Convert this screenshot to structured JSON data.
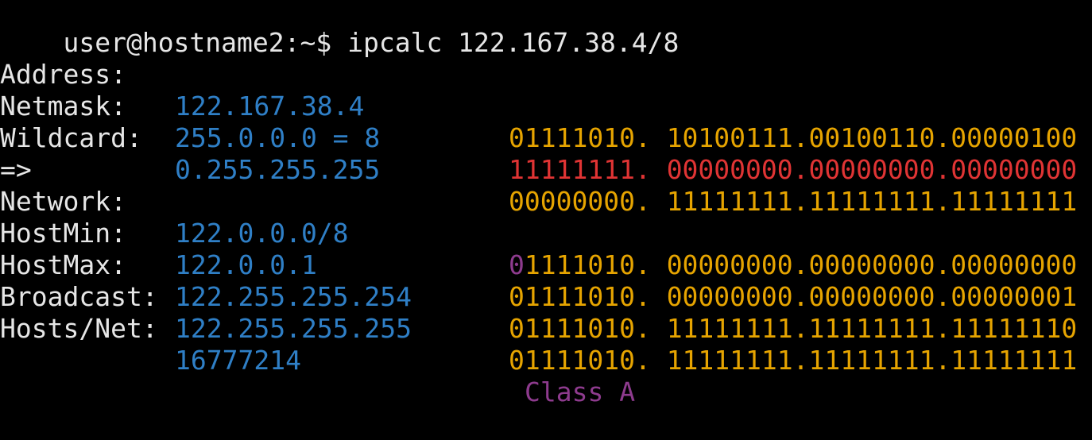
{
  "prompt": "user@hostname2:~$ ipcalc 122.167.38.4/8",
  "rows": [
    {
      "label": "Address:",
      "value": "122.167.38.4",
      "bin_first": "01111010",
      "bin_rest": ". 10100111.00100110.00000100"
    },
    {
      "label": "Netmask:",
      "value": "255.0.0.0 = 8",
      "bin_first": "11111111",
      "bin_rest": ". 00000000.00000000.00000000"
    },
    {
      "label": "Wildcard:",
      "value": "0.255.255.255",
      "bin_first": "00000000",
      "bin_rest": ". 11111111.11111111.11111111"
    },
    {
      "label": "=>"
    },
    {
      "label": "Network:",
      "value": "122.0.0.0/8",
      "bin_classbit": "0",
      "bin_first": "1111010",
      "bin_rest": ". 00000000.00000000.00000000"
    },
    {
      "label": "HostMin:",
      "value": "122.0.0.1",
      "bin_first": "01111010",
      "bin_rest": ". 00000000.00000000.00000001"
    },
    {
      "label": "HostMax:",
      "value": "122.255.255.254",
      "bin_first": "01111010",
      "bin_rest": ". 11111111.11111111.11111110"
    },
    {
      "label": "Broadcast:",
      "value": "122.255.255.255",
      "bin_first": "01111010",
      "bin_rest": ". 11111111.11111111.11111111"
    },
    {
      "label": "Hosts/Net:",
      "value": "16777214",
      "class_label": "Class A"
    }
  ],
  "colors": {
    "background": "#000000",
    "text": "#e6e6e6",
    "value_blue": "#2f7fc6",
    "binary_yellow": "#e6a400",
    "netmask_red": "#e03434",
    "class_purple": "#8e3b8e"
  }
}
